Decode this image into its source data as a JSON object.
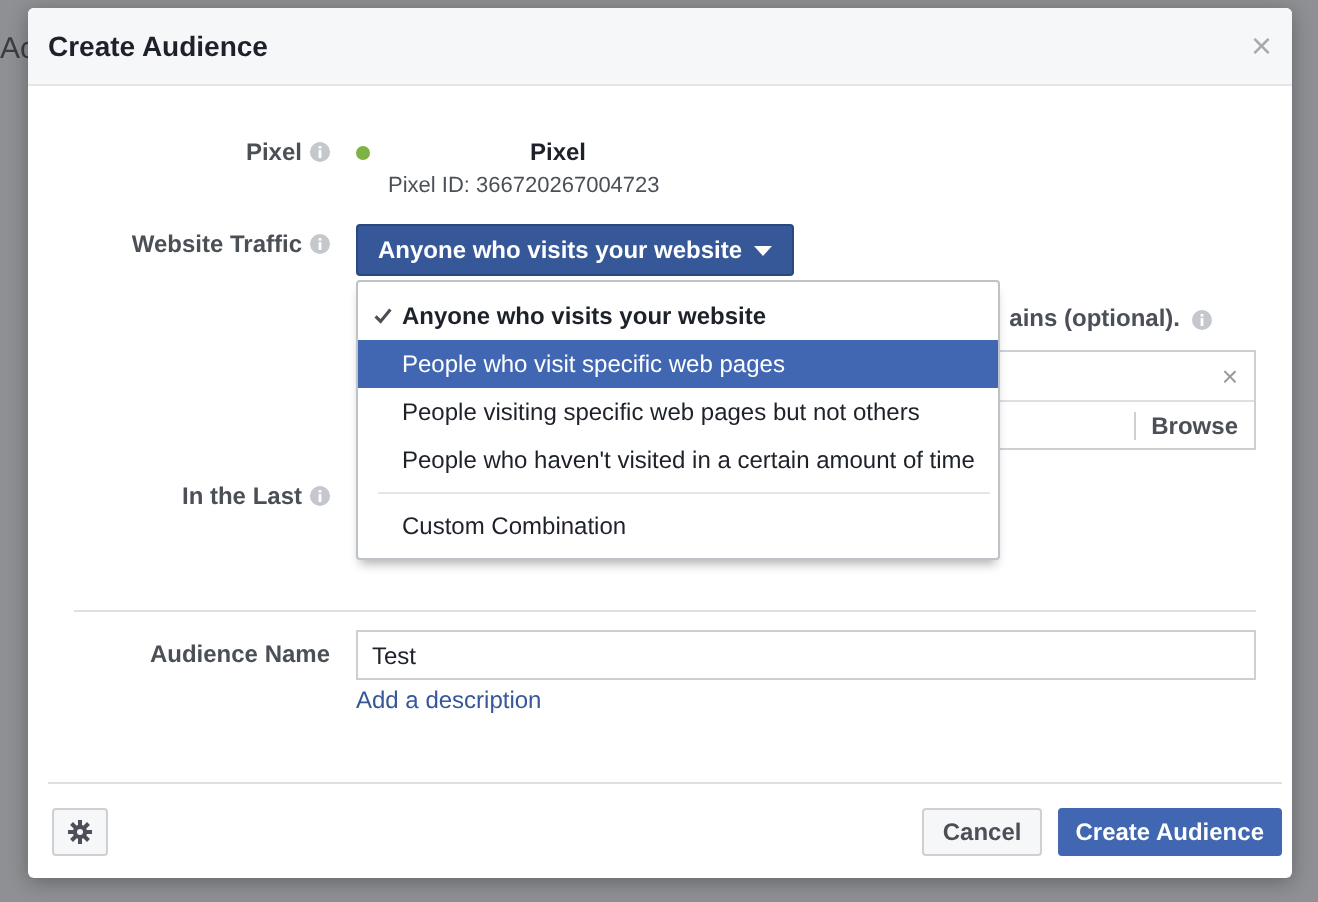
{
  "backdrop": {
    "text": "Ac"
  },
  "dialog": {
    "title": "Create Audience",
    "close": "×"
  },
  "pixel": {
    "label": "Pixel",
    "color": "#7cb342",
    "name": "Pixel",
    "id_text": "Pixel ID: 366720267004723"
  },
  "website_traffic": {
    "label": "Website Traffic",
    "button": "Anyone who visits your website",
    "expanded": true,
    "option_groups": [
      [
        {
          "label": "Anyone who visits your website",
          "checked": true,
          "selected": false
        },
        {
          "label": "People who visit specific web pages",
          "checked": false,
          "selected": true
        },
        {
          "label": "People visiting specific web pages but not others",
          "checked": false,
          "selected": false
        },
        {
          "label": "People who haven't visited in a certain amount of time",
          "checked": false,
          "selected": false
        }
      ],
      [
        {
          "label": "Custom Combination",
          "checked": false,
          "selected": false
        }
      ]
    ]
  },
  "domains": {
    "text": "ains (optional).",
    "clear": "×",
    "browse": "Browse"
  },
  "in_the_last": {
    "label": "In the Last"
  },
  "audience_name": {
    "label": "Audience Name",
    "value": "Test",
    "link": "Add a description"
  },
  "footer": {
    "cancel": "Cancel",
    "submit": "Create Audience"
  }
}
